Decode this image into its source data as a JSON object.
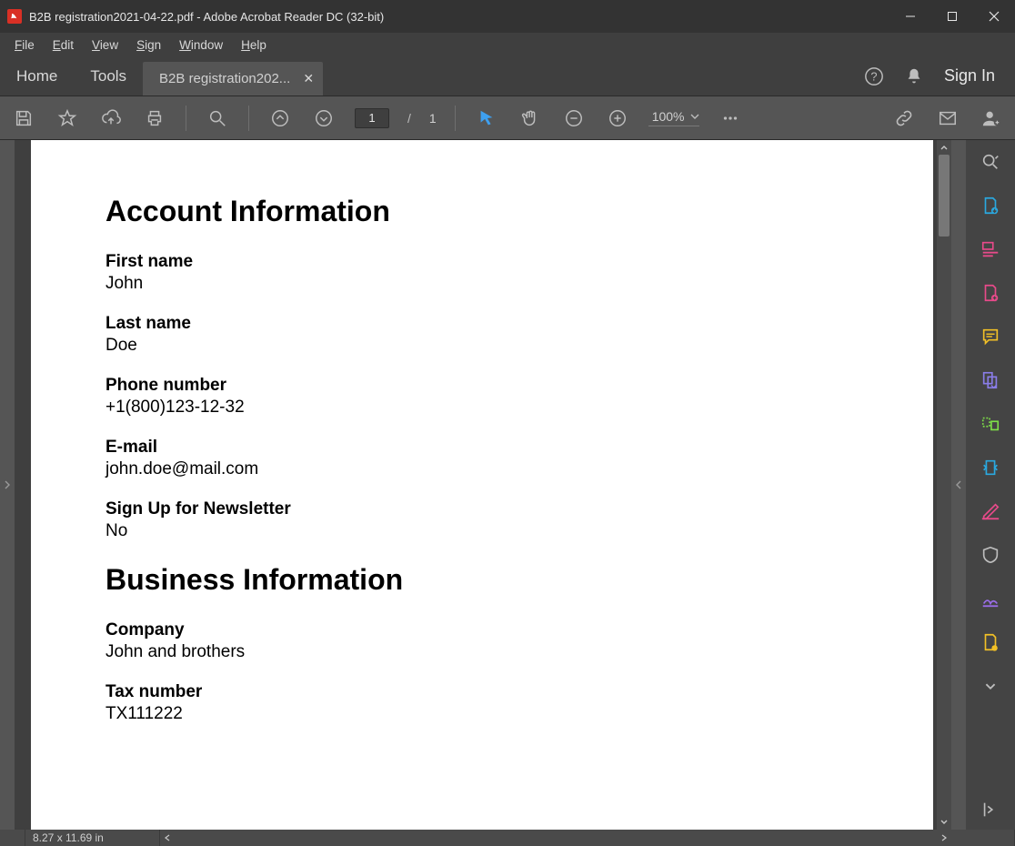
{
  "window": {
    "title": "B2B registration2021-04-22.pdf - Adobe Acrobat Reader DC (32-bit)"
  },
  "menu": {
    "file": "File",
    "edit": "Edit",
    "view": "View",
    "sign": "Sign",
    "window": "Window",
    "help": "Help"
  },
  "apptabs": {
    "home": "Home",
    "tools": "Tools",
    "doc": "B2B registration202..."
  },
  "header_right": {
    "signin": "Sign In"
  },
  "toolbar": {
    "current_page": "1",
    "page_sep": "/",
    "total_pages": "1",
    "zoom": "100%"
  },
  "document": {
    "section1_title": "Account Information",
    "fields1": [
      {
        "label": "First name",
        "value": "John"
      },
      {
        "label": "Last name",
        "value": "Doe"
      },
      {
        "label": "Phone number",
        "value": "+1(800)123-12-32"
      },
      {
        "label": "E-mail",
        "value": "john.doe@mail.com"
      },
      {
        "label": "Sign Up for Newsletter",
        "value": "No"
      }
    ],
    "section2_title": "Business Information",
    "fields2": [
      {
        "label": "Company",
        "value": "John and brothers"
      },
      {
        "label": "Tax number",
        "value": "TX111222"
      }
    ]
  },
  "statusbar": {
    "dimensions": "8.27 x 11.69 in"
  }
}
